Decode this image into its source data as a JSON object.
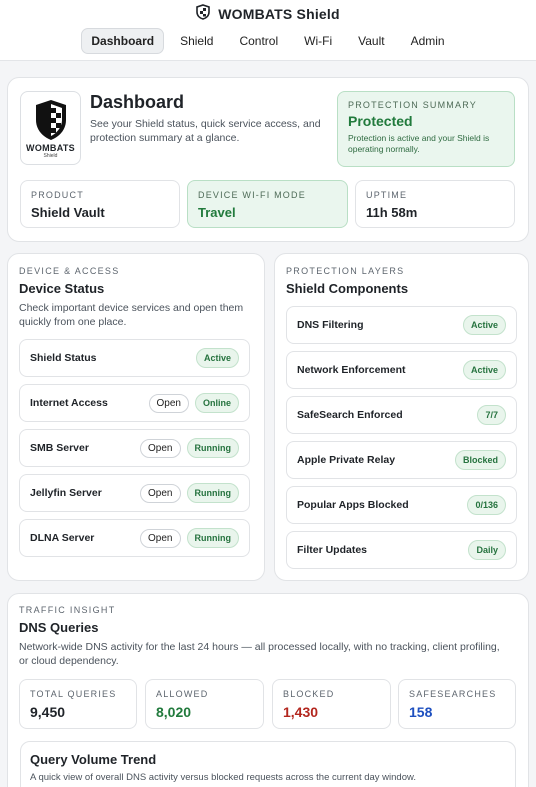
{
  "header": {
    "brand": "WOMBATS Shield",
    "nav": [
      "Dashboard",
      "Shield",
      "Control",
      "Wi-Fi",
      "Vault",
      "Admin"
    ],
    "active_nav": "Dashboard"
  },
  "hero": {
    "logo_word": "WOMBATS",
    "logo_sub": "Shield",
    "title": "Dashboard",
    "description": "See your Shield status, quick service access, and protection summary at a glance.",
    "protection": {
      "eyebrow": "PROTECTION SUMMARY",
      "status": "Protected",
      "detail": "Protection is active and your Shield is operating normally."
    },
    "stats": [
      {
        "label": "PRODUCT",
        "value": "Shield Vault"
      },
      {
        "label": "DEVICE WI-FI MODE",
        "value": "Travel"
      },
      {
        "label": "UPTIME",
        "value": "11h 58m"
      }
    ]
  },
  "device": {
    "eyebrow": "DEVICE & ACCESS",
    "title": "Device Status",
    "description": "Check important device services and open them quickly from one place.",
    "open_label": "Open",
    "rows": [
      {
        "label": "Shield Status",
        "status": "Active"
      },
      {
        "label": "Internet Access",
        "status": "Online"
      },
      {
        "label": "SMB Server",
        "status": "Running"
      },
      {
        "label": "Jellyfin Server",
        "status": "Running"
      },
      {
        "label": "DLNA Server",
        "status": "Running"
      }
    ]
  },
  "components": {
    "eyebrow": "PROTECTION LAYERS",
    "title": "Shield Components",
    "rows": [
      {
        "label": "DNS Filtering",
        "status": "Active"
      },
      {
        "label": "Network Enforcement",
        "status": "Active"
      },
      {
        "label": "SafeSearch Enforced",
        "status": "7/7"
      },
      {
        "label": "Apple Private Relay",
        "status": "Blocked"
      },
      {
        "label": "Popular Apps Blocked",
        "status": "0/136"
      },
      {
        "label": "Filter Updates",
        "status": "Daily"
      }
    ]
  },
  "traffic": {
    "eyebrow": "TRAFFIC INSIGHT",
    "title": "DNS Queries",
    "description": "Network-wide DNS activity for the last 24 hours — all processed locally, with no tracking, client profiling, or cloud dependency.",
    "metrics": [
      {
        "label": "TOTAL QUERIES",
        "value": "9,450",
        "color": "#1f2328"
      },
      {
        "label": "ALLOWED",
        "value": "8,020",
        "color": "#217a3c"
      },
      {
        "label": "BLOCKED",
        "value": "1,430",
        "color": "#b3261e"
      },
      {
        "label": "SAFESEARCHES",
        "value": "158",
        "color": "#1d4fbf"
      }
    ],
    "trend": {
      "title": "Query Volume Trend",
      "description": "A quick view of overall DNS activity versus blocked requests across the current day window."
    }
  }
}
